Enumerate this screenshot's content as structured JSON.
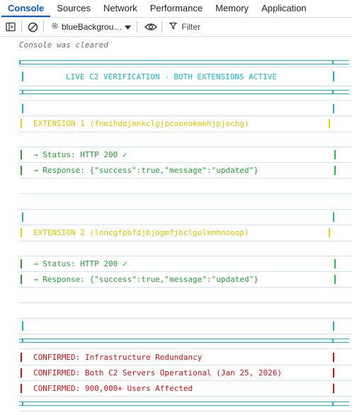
{
  "tabs": [
    {
      "label": "Console",
      "active": true
    },
    {
      "label": "Sources",
      "active": false
    },
    {
      "label": "Network",
      "active": false
    },
    {
      "label": "Performance",
      "active": false
    },
    {
      "label": "Memory",
      "active": false
    },
    {
      "label": "Application",
      "active": false
    }
  ],
  "toolbar": {
    "context": "blueBackgrou…",
    "filter_placeholder": "Filter"
  },
  "console": {
    "cleared": "Console was cleared",
    "banner_title": "LIVE C2 VERIFICATION - BOTH EXTENSIONS ACTIVE",
    "ext1": {
      "label": "EXTENSION 1 (fnmihdojmnkclgjpcoonokmkhjpjechg)",
      "status": "→ Status: HTTP 200 ✓",
      "response": "→ Response: {\"success\":true,\"message\":\"updated\"}"
    },
    "ext2": {
      "label": "EXTENSION 2 (lnncgfpbfdjbjogmfjbclgolkmhnooop)",
      "status": "→ Status: HTTP 200 ✓",
      "response": "→ Response: {\"success\":true,\"message\":\"updated\"}"
    },
    "confirmed": [
      "CONFIRMED: Infrastructure Redundancy",
      "CONFIRMED: Both C2 Servers Operational (Jan 25, 2026)",
      "CONFIRMED: 900,000+ Users Affected"
    ]
  },
  "colors": {
    "accent": "#0b57d0",
    "cyan": "#16b6c6",
    "yellow": "#d9c800",
    "green": "#23a033",
    "red": "#d01010"
  },
  "icons": [
    "dock-sidebar-icon",
    "clear-console-icon",
    "context-gear-icon",
    "dropdown-caret-icon",
    "eye-icon",
    "filter-funnel-icon"
  ]
}
